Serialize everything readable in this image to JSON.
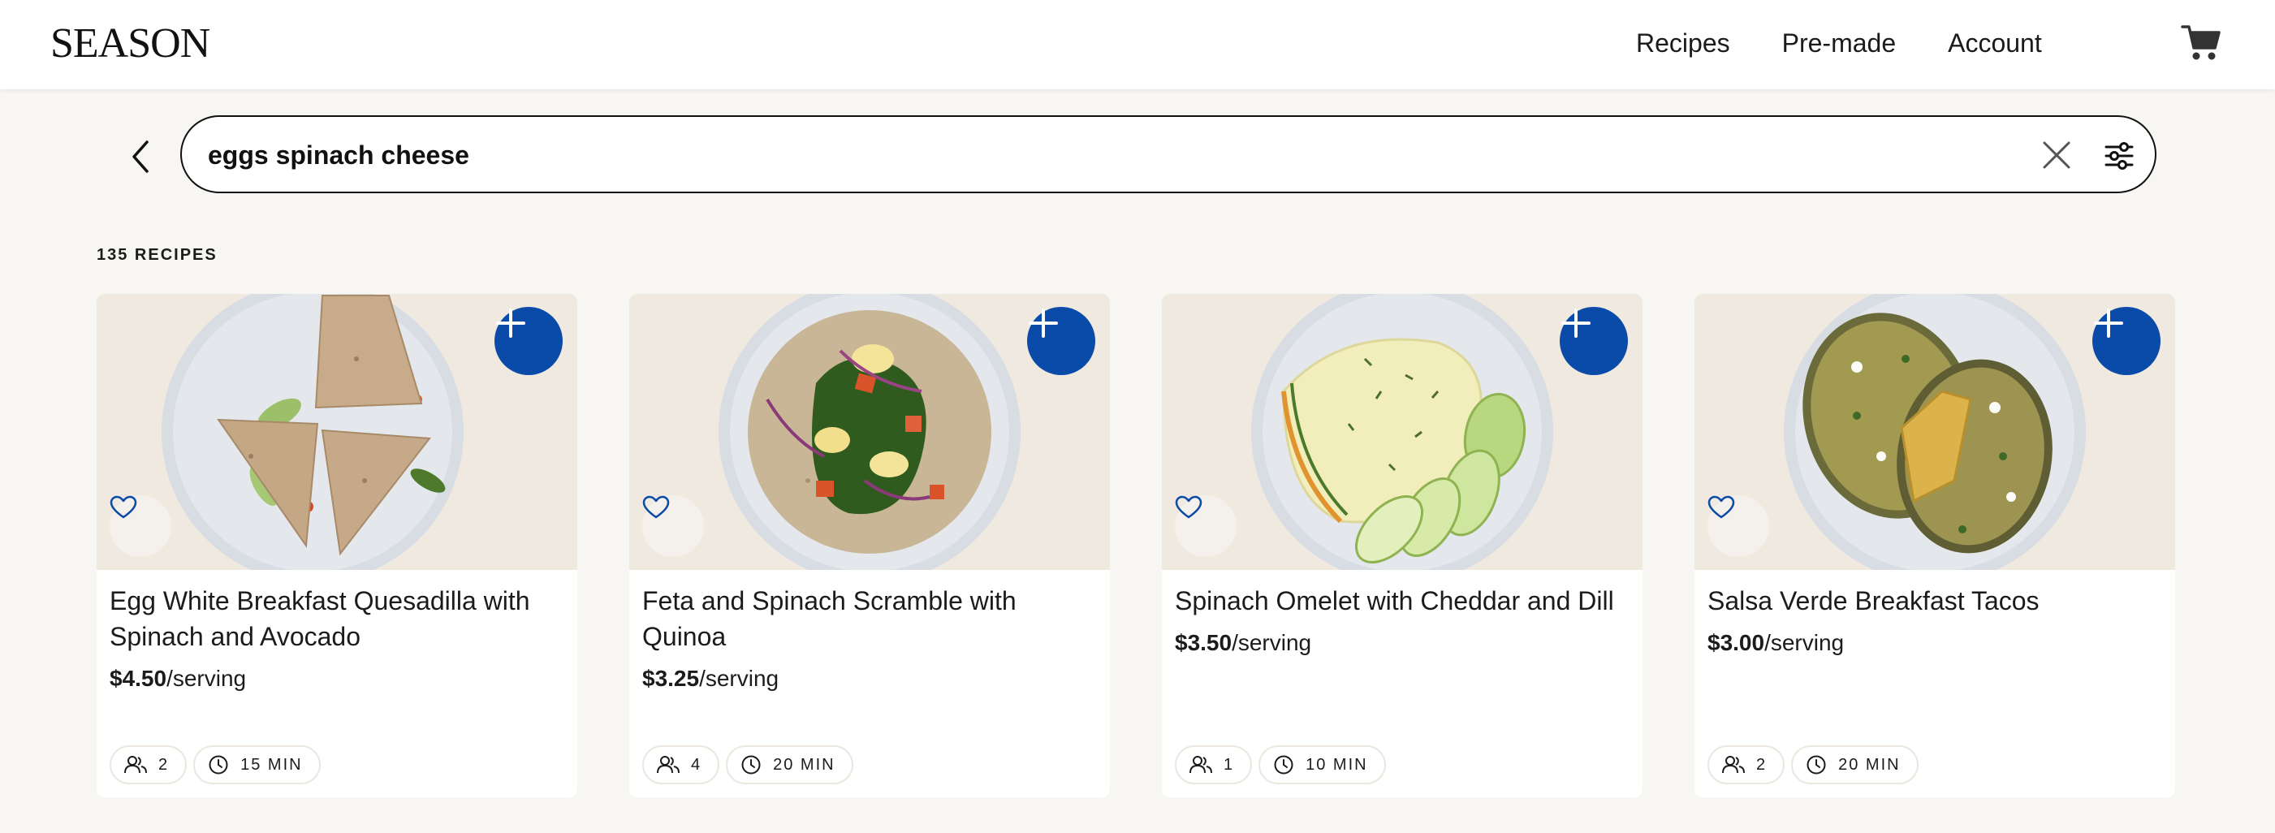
{
  "header": {
    "logo": "SEASON",
    "nav": [
      "Recipes",
      "Pre-made",
      "Account"
    ]
  },
  "search": {
    "query": "eggs spinach cheese",
    "placeholder": ""
  },
  "results": {
    "count_label": "135 RECIPES"
  },
  "cards": [
    {
      "title": "Egg White Breakfast Quesadilla with Spinach and Avocado",
      "price": "$4.50",
      "per": "/serving",
      "servings": "2",
      "time": "15 MIN"
    },
    {
      "title": "Feta and Spinach Scramble with Quinoa",
      "price": "$3.25",
      "per": "/serving",
      "servings": "4",
      "time": "20 MIN"
    },
    {
      "title": "Spinach Omelet with Cheddar and Dill",
      "price": "$3.50",
      "per": "/serving",
      "servings": "1",
      "time": "10 MIN"
    },
    {
      "title": "Salsa Verde Breakfast Tacos",
      "price": "$3.00",
      "per": "/serving",
      "servings": "2",
      "time": "20 MIN"
    }
  ],
  "colors": {
    "accent": "#0a4aa8",
    "background": "#f8f6f2",
    "image_background": "#efe9e0"
  }
}
